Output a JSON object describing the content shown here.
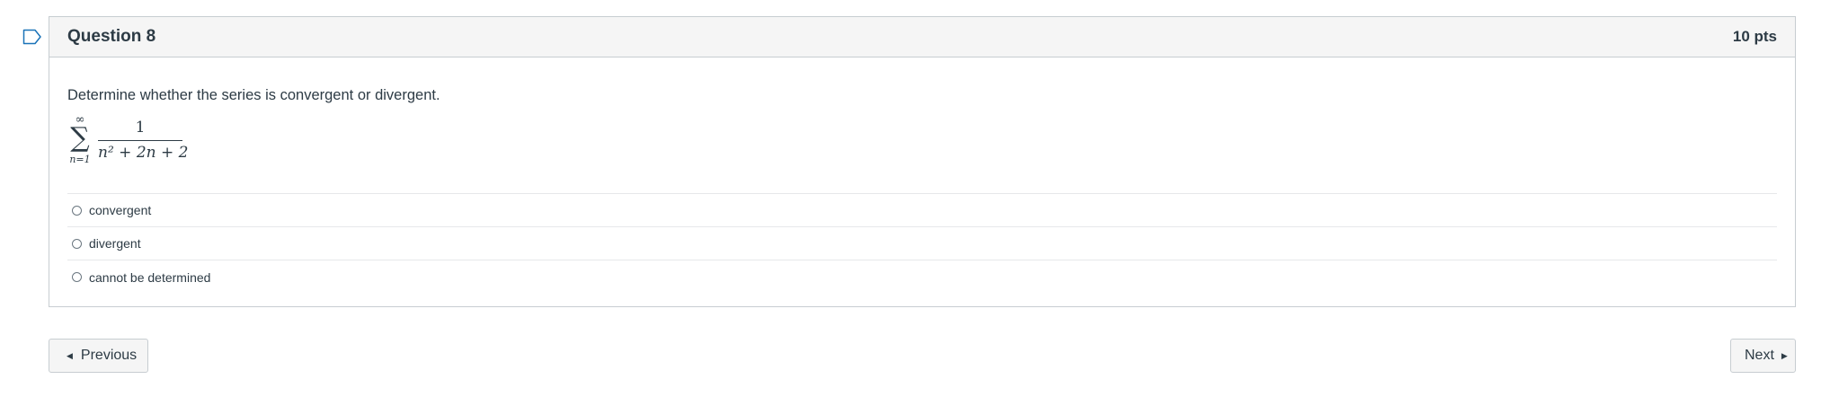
{
  "question": {
    "title": "Question 8",
    "points": "10 pts",
    "text": "Determine whether the series is convergent or divergent.",
    "series": {
      "upper": "∞",
      "lower": "n=1",
      "numerator": "1",
      "denominator": "n² + 2n + 2"
    },
    "answers": [
      {
        "label": "convergent",
        "selected": false
      },
      {
        "label": "divergent",
        "selected": false
      },
      {
        "label": "cannot be determined",
        "selected": false
      }
    ]
  },
  "navigation": {
    "previous_label": "Previous",
    "next_label": "Next"
  },
  "icons": {
    "flag": "flag-icon",
    "previous": "caret-left-icon",
    "next": "caret-right-icon"
  }
}
